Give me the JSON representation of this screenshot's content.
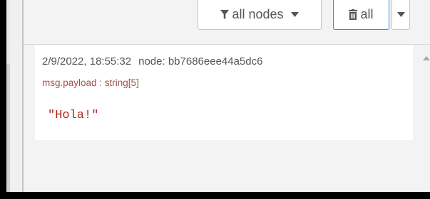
{
  "toolbar": {
    "filter_label": "all nodes",
    "clear_label": "all"
  },
  "message": {
    "timestamp": "2/9/2022, 18:55:32",
    "node": "node: bb7686eee44a5dc6",
    "topic": "msg.payload : string[5]",
    "value": "\"Hola!\""
  },
  "icons": {
    "filter": "filter-icon",
    "clear": "trash-icon",
    "dropdown": "caret-down-icon",
    "scroll": "scroll-up-arrow-icon"
  },
  "colors": {
    "topic": "#a0524a",
    "value": "#b5231b",
    "active_border": "#3b8ad9"
  }
}
